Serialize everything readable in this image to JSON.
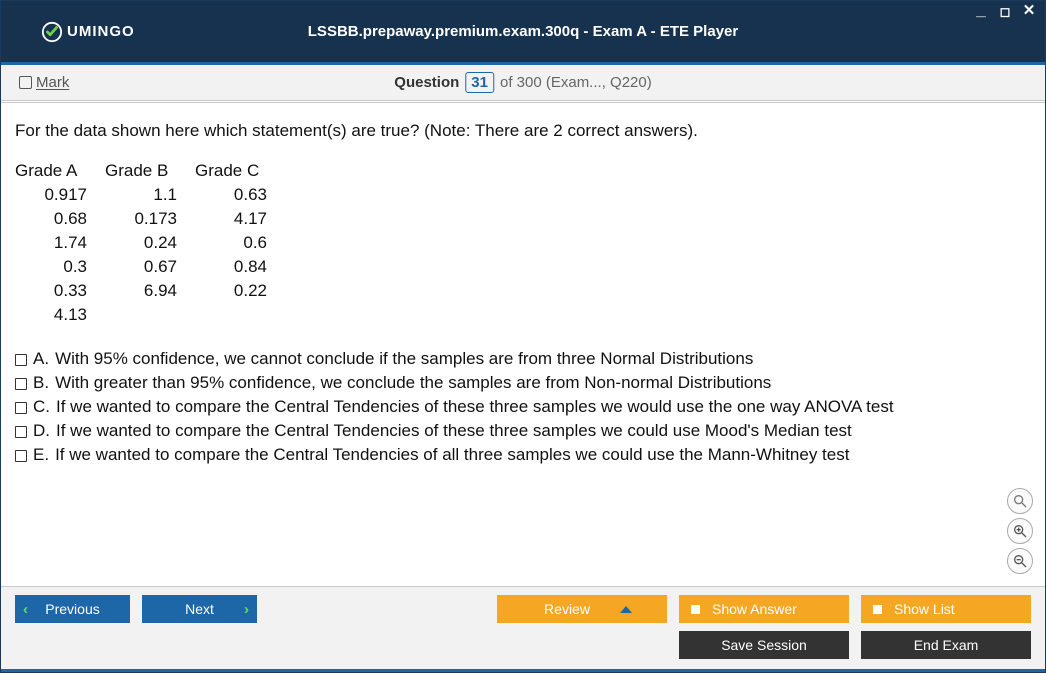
{
  "titlebar": {
    "logo_text": "UMINGO",
    "title": "LSSBB.prepaway.premium.exam.300q - Exam A - ETE Player"
  },
  "qheader": {
    "mark_label": "Mark",
    "question_word": "Question",
    "current": "31",
    "total_text": "of 300 (Exam..., Q220)"
  },
  "prompt": "For the data shown here which statement(s) are true? (Note: There are 2 correct answers).",
  "table": {
    "headers": [
      "Grade A",
      "Grade B",
      "Grade C"
    ],
    "rows": [
      [
        "0.917",
        "1.1",
        "0.63"
      ],
      [
        "0.68",
        "0.173",
        "4.17"
      ],
      [
        "1.74",
        "0.24",
        "0.6"
      ],
      [
        "0.3",
        "0.67",
        "0.84"
      ],
      [
        "0.33",
        "6.94",
        "0.22"
      ],
      [
        "4.13",
        "",
        ""
      ]
    ]
  },
  "answers": [
    {
      "letter": "A.",
      "text": "With 95% confidence, we cannot conclude if the samples are from three Normal Distributions"
    },
    {
      "letter": "B.",
      "text": "With greater than 95% confidence, we conclude the samples are from Non-normal Distributions"
    },
    {
      "letter": "C.",
      "text": "If we wanted to compare the Central Tendencies of these three samples we would use the one way ANOVA test"
    },
    {
      "letter": "D.",
      "text": "If we wanted to compare the Central Tendencies of these three samples we could use Mood's Median test"
    },
    {
      "letter": "E.",
      "text": "If we wanted to compare the Central Tendencies of all three samples we could use the Mann-Whitney test"
    }
  ],
  "footer": {
    "previous": "Previous",
    "next": "Next",
    "review": "Review",
    "show_answer": "Show Answer",
    "show_list": "Show List",
    "save_session": "Save Session",
    "end_exam": "End Exam"
  }
}
